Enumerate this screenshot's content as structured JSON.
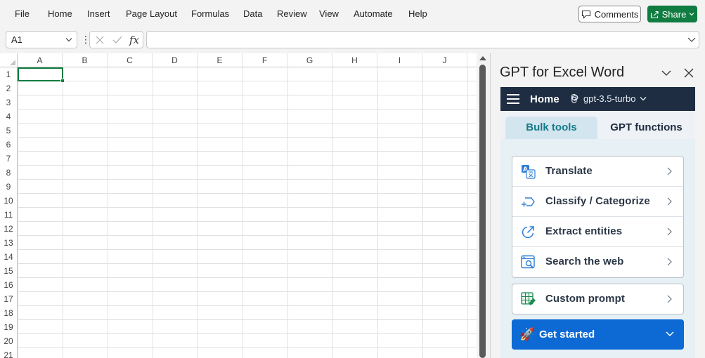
{
  "menu": {
    "items": [
      "File",
      "Home",
      "Insert",
      "Page Layout",
      "Formulas",
      "Data",
      "Review",
      "View",
      "Automate",
      "Help"
    ],
    "comments_label": "Comments",
    "share_label": "Share"
  },
  "formula_bar": {
    "name_box": "A1",
    "fx_label": "fx",
    "formula_value": ""
  },
  "grid": {
    "columns": [
      "A",
      "B",
      "C",
      "D",
      "E",
      "F",
      "G",
      "H",
      "I",
      "J"
    ],
    "rows": [
      "1",
      "2",
      "3",
      "4",
      "5",
      "6",
      "7",
      "8",
      "9",
      "10",
      "11",
      "12",
      "13",
      "14",
      "15",
      "16",
      "17",
      "18",
      "19",
      "20",
      "21"
    ],
    "selected_cell": "A1"
  },
  "side_panel": {
    "title": "GPT for Excel Word",
    "header": {
      "home_label": "Home",
      "model": "gpt-3.5-turbo"
    },
    "tabs": [
      {
        "label": "Bulk tools",
        "active": true
      },
      {
        "label": "GPT functions",
        "active": false
      }
    ],
    "tools": [
      {
        "label": "Translate",
        "icon": "translate-icon"
      },
      {
        "label": "Classify / Categorize",
        "icon": "classify-icon"
      },
      {
        "label": "Extract entities",
        "icon": "extract-icon"
      },
      {
        "label": "Search the web",
        "icon": "search-web-icon"
      }
    ],
    "custom_prompt_label": "Custom prompt",
    "get_started_label": "Get started"
  },
  "colors": {
    "excel_green": "#107c41",
    "panel_header": "#1f2d42",
    "accent_blue": "#0d6ad4",
    "tab_active_text": "#167a8a"
  }
}
